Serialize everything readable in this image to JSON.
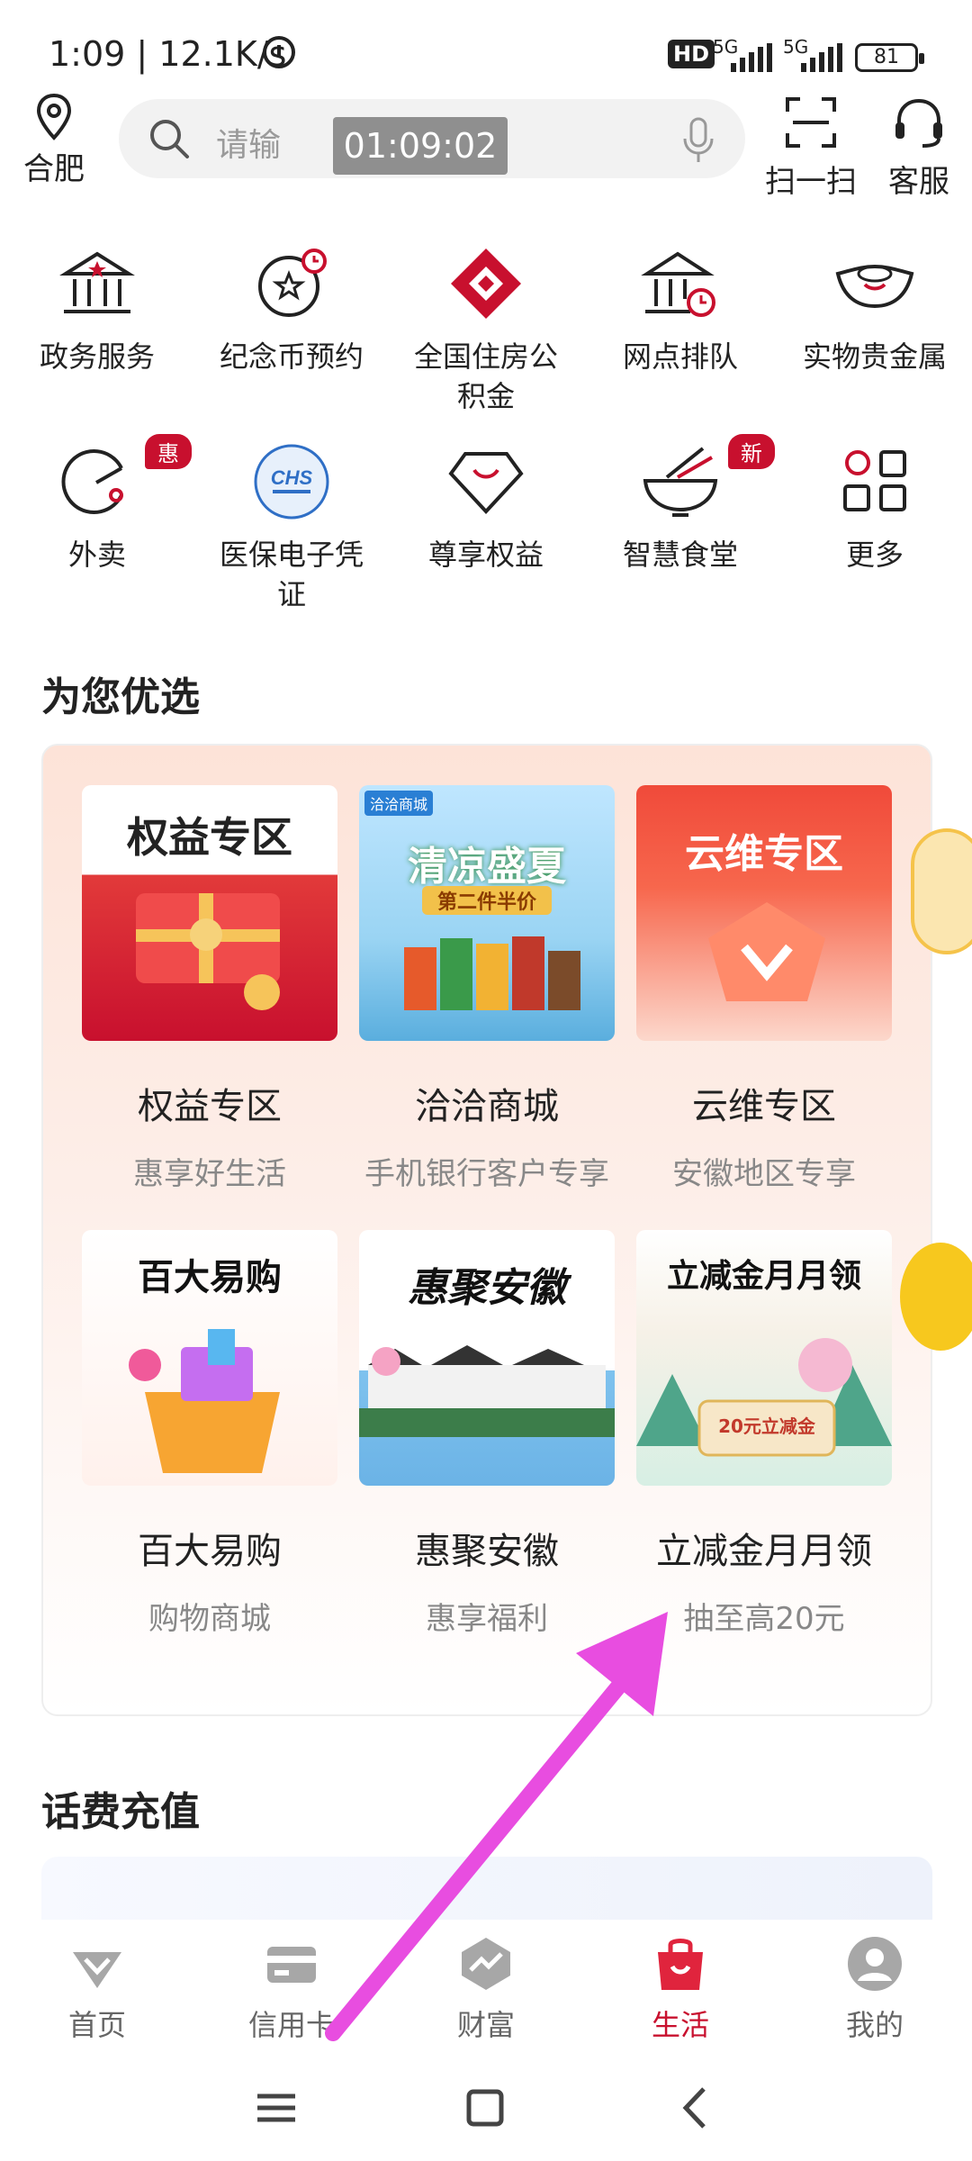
{
  "status": {
    "time_speed": "1:09 | 12.1K/s",
    "hd": "HD",
    "net1": "5G",
    "net2": "5G",
    "battery": "81"
  },
  "header": {
    "location": "合肥",
    "search_placeholder": "请输",
    "timer_overlay": "01:09:02",
    "scan_label": "扫一扫",
    "service_label": "客服"
  },
  "services": [
    {
      "label": "政务服务",
      "icon": "government-building-icon"
    },
    {
      "label": "纪念币预约",
      "icon": "coin-star-icon"
    },
    {
      "label": "全国住房公积金",
      "icon": "housing-fund-logo-icon"
    },
    {
      "label": "网点排队",
      "icon": "branch-queue-icon"
    },
    {
      "label": "实物贵金属",
      "icon": "gold-ingot-icon"
    },
    {
      "label": "外卖",
      "icon": "takeout-icon",
      "badge": "惠"
    },
    {
      "label": "医保电子凭证",
      "icon": "chs-medical-icon"
    },
    {
      "label": "尊享权益",
      "icon": "diamond-icon"
    },
    {
      "label": "智慧食堂",
      "icon": "bowl-icon",
      "badge": "新"
    },
    {
      "label": "更多",
      "icon": "grid-more-icon"
    }
  ],
  "picks_title": "为您优选",
  "picks": [
    {
      "title": "权益专区",
      "subtitle": "惠享好生活",
      "thumb_text": "权益专区"
    },
    {
      "title": "洽洽商城",
      "subtitle": "手机银行客户专享",
      "thumb_text": "清凉盛夏",
      "thumb_sub": "第二件半价",
      "thumb_tag": "洽洽商城"
    },
    {
      "title": "云维专区",
      "subtitle": "安徽地区专享",
      "thumb_text": "云维专区"
    },
    {
      "title": "百大易购",
      "subtitle": "购物商城",
      "thumb_text": "百大易购"
    },
    {
      "title": "惠聚安徽",
      "subtitle": "惠享福利",
      "thumb_text": "惠聚安徽"
    },
    {
      "title": "立减金月月领",
      "subtitle": "抽至高20元",
      "thumb_text": "立减金月月领",
      "thumb_sub": "20元立减金"
    }
  ],
  "recharge_title": "话费充值",
  "tabs": [
    {
      "label": "首页",
      "icon": "home-diamond-icon"
    },
    {
      "label": "信用卡",
      "icon": "credit-card-icon"
    },
    {
      "label": "财富",
      "icon": "wealth-icon"
    },
    {
      "label": "生活",
      "icon": "shopping-bag-icon",
      "active": true
    },
    {
      "label": "我的",
      "icon": "profile-icon"
    }
  ],
  "colors": {
    "accent": "#c8102e",
    "picks_bg": "#fde3d8",
    "annotation_arrow": "#e84de0"
  }
}
